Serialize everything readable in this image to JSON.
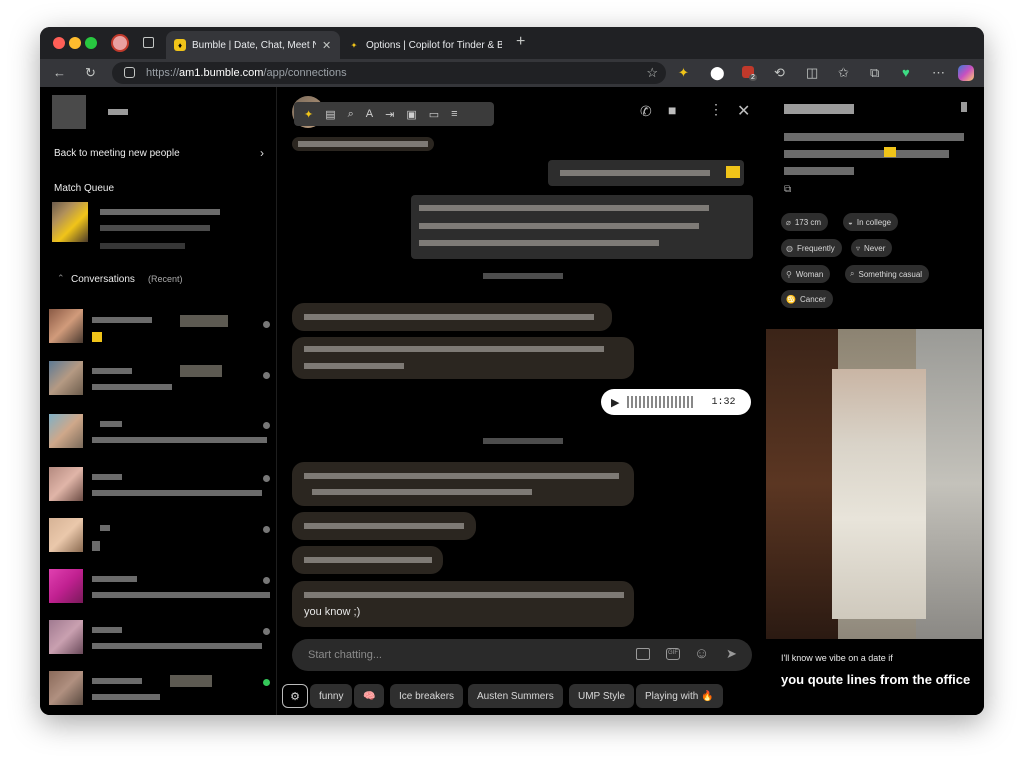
{
  "browser": {
    "tabs": [
      {
        "title": "Bumble | Date, Chat, Meet New",
        "active": true
      },
      {
        "title": "Options | Copilot for Tinder & B",
        "active": false
      }
    ],
    "new_tab_icon": "plus-icon",
    "url": {
      "scheme": "https://",
      "host": "am1.bumble.com",
      "path": "/app/connections"
    },
    "extension_badge": "2"
  },
  "sidebar": {
    "back_link": "Back to meeting new people",
    "match_queue_label": "Match Queue",
    "conversations_label": "Conversations",
    "conversations_filter": "(Recent)"
  },
  "chat": {
    "voice_message_duration": "1:32",
    "last_message_tail": "you know ;)",
    "input_placeholder": "Start chatting...",
    "suggestion_chips": [
      "funny",
      "🧠",
      "Ice breakers",
      "Austen Summers",
      "UMP Style",
      "Playing with 🔥"
    ]
  },
  "profile": {
    "tags": [
      {
        "icon": "ruler-icon",
        "label": "173 cm"
      },
      {
        "icon": "graduation-cap-icon",
        "label": "In college"
      },
      {
        "icon": "fitness-icon",
        "label": "Frequently"
      },
      {
        "icon": "drink-icon",
        "label": "Never"
      },
      {
        "icon": "gender-icon",
        "label": "Woman"
      },
      {
        "icon": "search-heart-icon",
        "label": "Something casual"
      },
      {
        "icon": "zodiac-icon",
        "label": "Cancer"
      }
    ],
    "prompt_question": "I'll know we vibe on a date if",
    "prompt_answer": "you qoute lines from the office"
  },
  "colors": {
    "background": "#000000",
    "bubble_them": "#2b2620",
    "bubble_me": "#2d2d2d",
    "online_dot": "#34c759",
    "accent_yellow": "#f0c419"
  }
}
